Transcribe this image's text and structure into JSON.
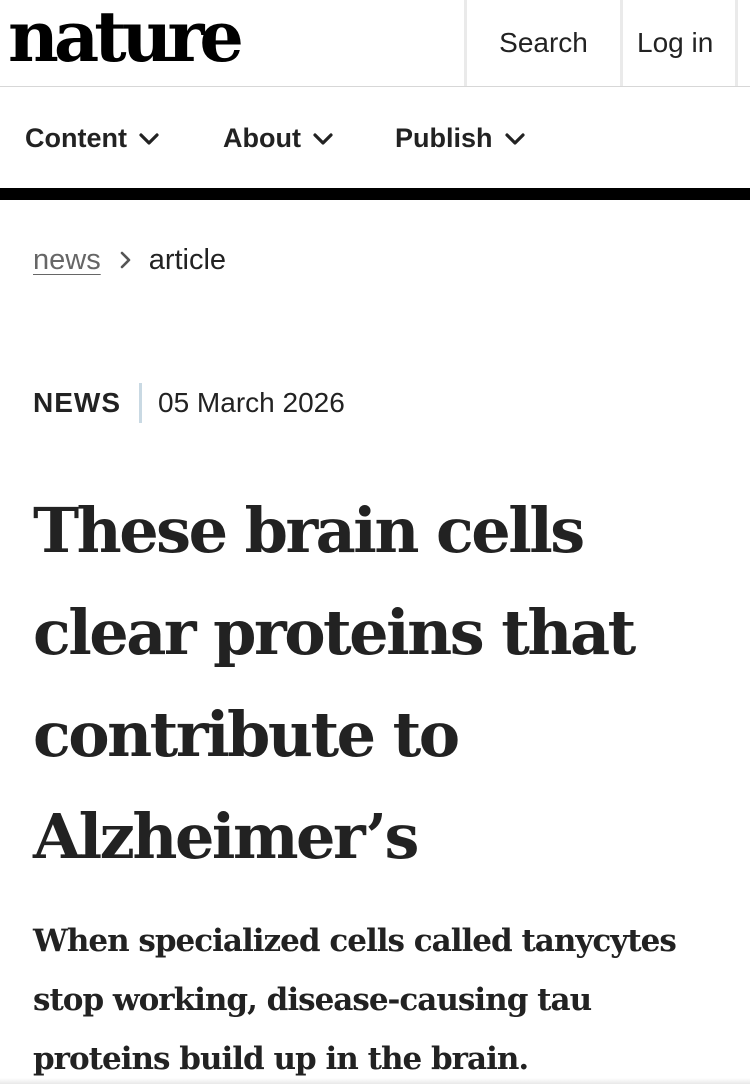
{
  "header": {
    "logo_text": "nature",
    "search_label": "Search",
    "login_label": "Log in"
  },
  "nav": {
    "items": [
      {
        "label": "Content",
        "icon": "chevron-down-icon"
      },
      {
        "label": "About",
        "icon": "chevron-down-icon"
      },
      {
        "label": "Publish",
        "icon": "chevron-down-icon"
      }
    ]
  },
  "breadcrumb": {
    "items": [
      {
        "label": "news",
        "link": true
      },
      {
        "label": "article",
        "link": false
      }
    ],
    "separator_icon": "chevron-right-icon"
  },
  "article": {
    "type": "NEWS",
    "date": "05 March 2026",
    "title": "These brain cells clear proteins that contribute to Alzheimer’s",
    "standfirst": "When specialized cells called tanycytes stop working, disease-causing tau proteins build up in the brain."
  },
  "colors": {
    "text": "#222222",
    "muted_link": "#666666",
    "rule": "#000000",
    "meta_divider": "#c9d9e3"
  }
}
